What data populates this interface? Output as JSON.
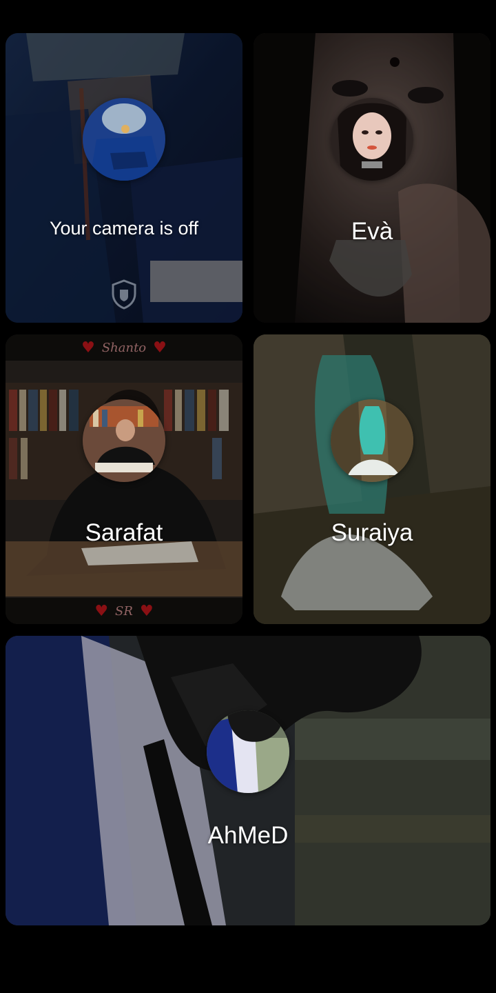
{
  "call": {
    "participants": [
      {
        "id": "self",
        "label": "Your camera is off",
        "status": "camera-off",
        "icon": "shield-icon"
      },
      {
        "id": "eva",
        "label": "Evà"
      },
      {
        "id": "sarafat",
        "label": "Sarafat",
        "banner_top": "Shanto",
        "banner_bottom": "SR"
      },
      {
        "id": "suraiya",
        "label": "Suraiya"
      },
      {
        "id": "ahmed",
        "label": "AhMeD"
      }
    ]
  },
  "colors": {
    "background": "#000000",
    "name_text": "#ffffff",
    "self_tile_tint": "#10203f",
    "eva_tile_tint": "#2a2624",
    "sarafat_tile_tint": "#231f1c",
    "suraiya_tile_tint": "#3e3a2c",
    "ahmed_tile_tint": "#1d2533"
  }
}
